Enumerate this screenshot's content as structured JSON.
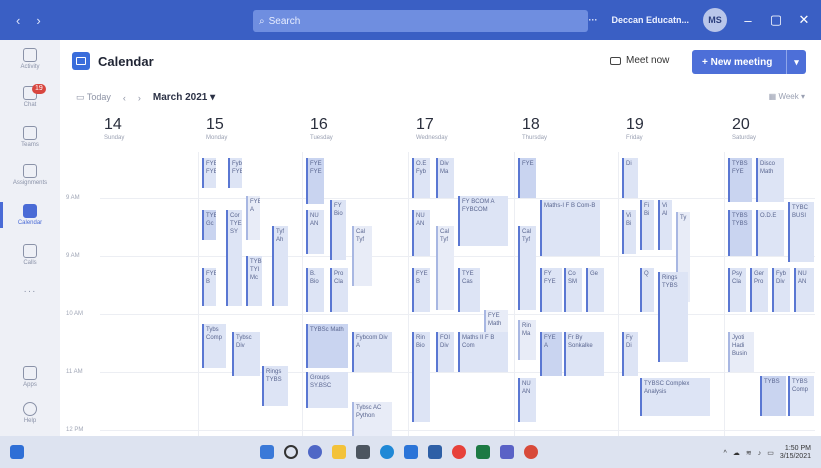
{
  "titlebar": {
    "search_placeholder": "Search",
    "more": "···",
    "org": "Deccan Educatn...",
    "avatar_initials": "MS",
    "minimize": "–",
    "maximize": "▢",
    "close": "✕"
  },
  "rail": {
    "items": [
      {
        "label": "Activity"
      },
      {
        "label": "Chat",
        "badge": "19"
      },
      {
        "label": "Teams"
      },
      {
        "label": "Assignments"
      },
      {
        "label": "Calendar"
      },
      {
        "label": "Calls"
      },
      {
        "label": "···"
      },
      {
        "label": "Apps"
      },
      {
        "label": "Help"
      }
    ]
  },
  "header": {
    "title": "Calendar",
    "meet_now": "Meet now",
    "new_meeting": "+ New meeting"
  },
  "toolbar": {
    "today": "Today",
    "month": "March 2021",
    "view": "Week"
  },
  "days": [
    {
      "num": "14",
      "name": "Sunday"
    },
    {
      "num": "15",
      "name": "Monday"
    },
    {
      "num": "16",
      "name": "Tuesday"
    },
    {
      "num": "17",
      "name": "Wednesday"
    },
    {
      "num": "18",
      "name": "Thursday"
    },
    {
      "num": "19",
      "name": "Friday"
    },
    {
      "num": "20",
      "name": "Saturday"
    }
  ],
  "times": [
    "9 AM",
    "9 AM",
    "10 AM",
    "11 AM",
    "12 PM"
  ],
  "events": {
    "e1": "FYE FYE",
    "e2": "Fyb FYE",
    "e3": "FYE A",
    "e4": "TYE Gc",
    "e5": "Cor TYE SY",
    "e6": "Tyf Ah",
    "e7": "FYE B",
    "e8": "TYB TYI Mc",
    "e9": "Tybs Comp",
    "e10": "Tybsc Div",
    "e11": "Rings TYBS",
    "e12": "FYE FYE",
    "e13": "FY Bio",
    "e14": "NU AN",
    "e15": "Cal Tyf",
    "e16": "B. Bio",
    "e17": "Pro Cla",
    "e18": "TYBSc Math",
    "e19": "Fybcom Div A",
    "e20": "Groups SY.BSC",
    "e21": "Tybsc AC Python",
    "e22": "O.E Fyb",
    "e23": "Div Ma",
    "e24": "FY BCOM A FYBCOM",
    "e25": "NU AN",
    "e26": "Cal Tyf",
    "e27": "FYE B",
    "e28": "TYE Cas",
    "e29": "FYE Math",
    "e30": "FOI Div",
    "e31": "Maths II F B Com",
    "e32": "Rin Bio",
    "e33": "FYE",
    "e34": "Maths-I F B Com-B",
    "e35": "Cal Tyf",
    "e36": "FY FYE",
    "e37": "Co SM",
    "e38": "Ge",
    "e39": "Rin Ma",
    "e40": "FYE A",
    "e41": "Fr By Sonkalke",
    "e42": "NU AN",
    "e43": "Di",
    "e44": "Vi Bi",
    "e45": "Fi Bi",
    "e46": "Vi Al",
    "e47": "Ty",
    "e48": "Q",
    "e49": "Rings TYBS",
    "e50": "Fy Di",
    "e51": "TYBSC Complex Analysis",
    "e52": "TYBS FYE",
    "e53": "Disco Math",
    "e54": "TYBS TYBS",
    "e55": "O.D.E",
    "e56": "TYBC BUSI",
    "e57": "Psy Cla",
    "e58": "Ger Pro",
    "e59": "Fyb Div",
    "e60": "NU AN",
    "e61": "Jyoti Hadi Busin",
    "e62": "TYBS",
    "e63": "TYBS Comp"
  }
}
